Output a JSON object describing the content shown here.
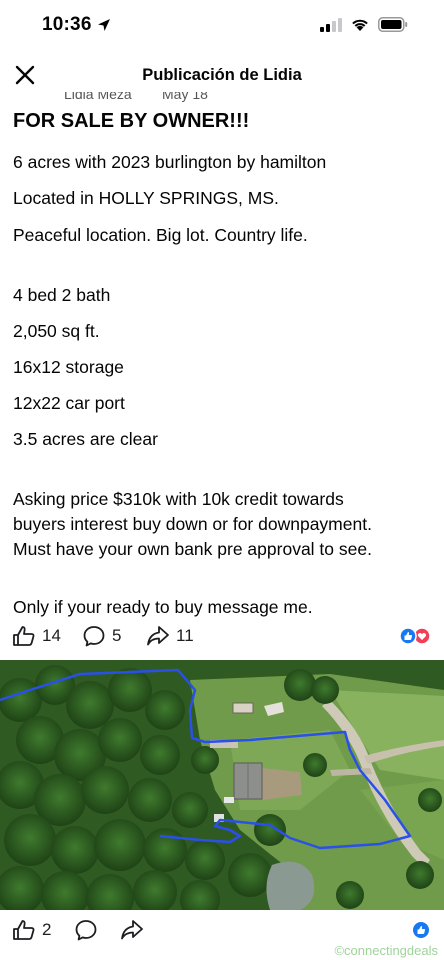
{
  "status": {
    "time": "10:36"
  },
  "nav": {
    "title": "Publicación de Lidia"
  },
  "post": {
    "author_partial": "Lidia Meza",
    "date_partial": "May 18",
    "headline": "FOR SALE BY OWNER!!!",
    "lines": [
      "6 acres with 2023 burlington by hamilton",
      "Located in HOLLY SPRINGS, MS.",
      "Peaceful location. Big lot. Country life.",
      "4 bed 2 bath",
      "2,050 sq ft.",
      "16x12 storage",
      "12x22 car port",
      "3.5 acres are clear",
      "Asking price $310k with 10k credit towards",
      "buyers interest buy down or for downpayment.",
      "Must have your own bank pre approval to see.",
      "Only if your ready to buy message me."
    ]
  },
  "post_actions": {
    "likes": "14",
    "comments": "5",
    "shares": "11"
  },
  "photo_actions": {
    "likes": "2"
  },
  "watermark": "©connectingdeals",
  "icons": [
    "location-arrow-icon",
    "signal-icon",
    "wifi-icon",
    "battery-icon",
    "close-icon",
    "like-icon",
    "comment-icon",
    "share-icon",
    "reactions-icon"
  ],
  "colors": {
    "accent": "#1877f2",
    "love": "#f33e58",
    "boundary": "#2950e8"
  }
}
